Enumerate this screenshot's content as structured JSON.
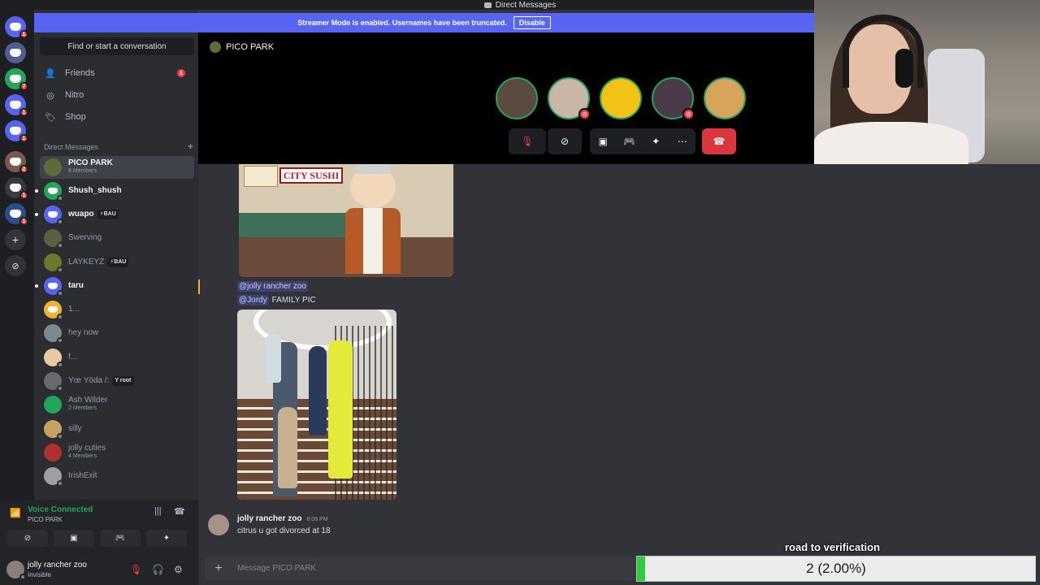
{
  "window": {
    "title": "Direct Messages"
  },
  "streamer_banner": {
    "text": "Streamer Mode is enabled. Usernames have been truncated.",
    "button": "Disable"
  },
  "servers": [
    {
      "name": "home",
      "badge": "1",
      "color": "#5865f2"
    },
    {
      "name": "server-2",
      "badge": "",
      "color": "#4e5d94"
    },
    {
      "name": "server-3",
      "badge": "7",
      "color": "#23a55a"
    },
    {
      "name": "server-4",
      "badge": "1",
      "color": "#5865f2"
    },
    {
      "name": "server-5",
      "badge": "1",
      "color": "#5865f2"
    },
    {
      "name": "server-6",
      "badge": "2",
      "color": "#7b5a4a"
    },
    {
      "name": "server-7",
      "badge": "1",
      "color": "#3a3a3a"
    },
    {
      "name": "server-8",
      "badge": "1",
      "color": "#2b4f8a"
    }
  ],
  "sidebar": {
    "search_label": "Find or start a conversation",
    "nav": [
      {
        "label": "Friends",
        "badge": "1",
        "icon": "friends-icon"
      },
      {
        "label": "Nitro",
        "badge": "",
        "icon": "nitro-icon"
      },
      {
        "label": "Shop",
        "badge": "",
        "icon": "shop-icon"
      }
    ],
    "dm_header": "Direct Messages",
    "dms": [
      {
        "name": "PICO PARK",
        "sub": "8 Members",
        "tag": "",
        "bold": true,
        "selected": true,
        "color": "#5d6b3a"
      },
      {
        "name": "Shush_shush",
        "sub": "",
        "tag": "",
        "bold": true,
        "color": "#23a55a",
        "discord": true
      },
      {
        "name": "wuapo",
        "sub": "",
        "tag": "⚡BAU",
        "bold": true,
        "color": "#5865f2",
        "discord": true
      },
      {
        "name": "Swerving",
        "sub": "",
        "tag": "",
        "bold": false,
        "color": "#5a6040"
      },
      {
        "name": "LAYKEYZ",
        "sub": "",
        "tag": "⚡BAU",
        "bold": false,
        "color": "#6a7a2a"
      },
      {
        "name": "taru",
        "sub": "",
        "tag": "",
        "bold": true,
        "color": "#5865f2",
        "discord": true
      },
      {
        "name": "1...",
        "sub": "",
        "tag": "",
        "bold": false,
        "color": "#f0b232",
        "discord": true
      },
      {
        "name": "hey now",
        "sub": "",
        "tag": "",
        "bold": false,
        "color": "#7b8a8a"
      },
      {
        "name": "f...",
        "sub": "",
        "tag": "",
        "bold": false,
        "color": "#e8c8a0"
      },
      {
        "name": "Yœ Yōda /:",
        "sub": "",
        "tag": "Y root",
        "bold": false,
        "color": "#6a6a6a"
      },
      {
        "name": "Ash Wilder",
        "sub": "2 Members",
        "tag": "",
        "bold": false,
        "color": "#23a55a"
      },
      {
        "name": "silly",
        "sub": "",
        "tag": "",
        "bold": false,
        "color": "#c8a060"
      },
      {
        "name": "jolly cuties",
        "sub": "4 Members",
        "tag": "",
        "bold": false,
        "color": "#b03030"
      },
      {
        "name": "IrishExit",
        "sub": "",
        "tag": "",
        "bold": false,
        "color": "#a0a0a0"
      }
    ]
  },
  "voice": {
    "status": "Voice Connected",
    "channel": "PICO PARK"
  },
  "user": {
    "name": "jolly rancher zoo",
    "status": "Invisible"
  },
  "call": {
    "title": "PICO PARK",
    "participants": [
      {
        "color": "#5a4a40",
        "muted": false
      },
      {
        "color": "#c9b6a8",
        "muted": true
      },
      {
        "color": "#f2c316",
        "muted": false
      },
      {
        "color": "#4a3a48",
        "muted": true
      },
      {
        "color": "#d6a45a",
        "muted": false
      }
    ]
  },
  "image1": {
    "sign_text": "CITY SUSHI"
  },
  "messages": {
    "mention1": "@jolly rancher zoo",
    "mention2": "@Jordy",
    "line2_text": "FAMILY PIC",
    "author": "jolly rancher zoo",
    "time": "8:08 PM",
    "text": "citrus u got divorced at 18"
  },
  "composer": {
    "placeholder": "Message PICO PARK"
  },
  "overlay": {
    "title": "road to verification",
    "value_text": "2 (2.00%)",
    "progress_fraction": 0.02,
    "bar_color": "#2ecc40"
  }
}
